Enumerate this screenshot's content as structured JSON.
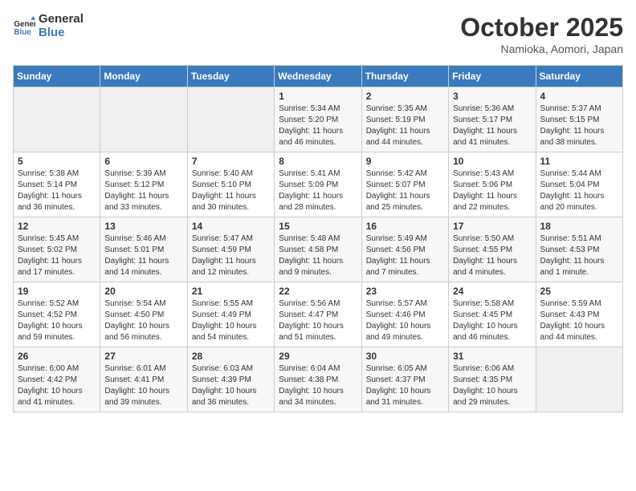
{
  "header": {
    "logo_line1": "General",
    "logo_line2": "Blue",
    "title": "October 2025",
    "subtitle": "Namioka, Aomori, Japan"
  },
  "weekdays": [
    "Sunday",
    "Monday",
    "Tuesday",
    "Wednesday",
    "Thursday",
    "Friday",
    "Saturday"
  ],
  "weeks": [
    [
      {
        "day": "",
        "empty": true
      },
      {
        "day": "",
        "empty": true
      },
      {
        "day": "",
        "empty": true
      },
      {
        "day": "1",
        "sunrise": "5:34 AM",
        "sunset": "5:20 PM",
        "daylight": "11 hours and 46 minutes."
      },
      {
        "day": "2",
        "sunrise": "5:35 AM",
        "sunset": "5:19 PM",
        "daylight": "11 hours and 44 minutes."
      },
      {
        "day": "3",
        "sunrise": "5:36 AM",
        "sunset": "5:17 PM",
        "daylight": "11 hours and 41 minutes."
      },
      {
        "day": "4",
        "sunrise": "5:37 AM",
        "sunset": "5:15 PM",
        "daylight": "11 hours and 38 minutes."
      }
    ],
    [
      {
        "day": "5",
        "sunrise": "5:38 AM",
        "sunset": "5:14 PM",
        "daylight": "11 hours and 36 minutes."
      },
      {
        "day": "6",
        "sunrise": "5:39 AM",
        "sunset": "5:12 PM",
        "daylight": "11 hours and 33 minutes."
      },
      {
        "day": "7",
        "sunrise": "5:40 AM",
        "sunset": "5:10 PM",
        "daylight": "11 hours and 30 minutes."
      },
      {
        "day": "8",
        "sunrise": "5:41 AM",
        "sunset": "5:09 PM",
        "daylight": "11 hours and 28 minutes."
      },
      {
        "day": "9",
        "sunrise": "5:42 AM",
        "sunset": "5:07 PM",
        "daylight": "11 hours and 25 minutes."
      },
      {
        "day": "10",
        "sunrise": "5:43 AM",
        "sunset": "5:06 PM",
        "daylight": "11 hours and 22 minutes."
      },
      {
        "day": "11",
        "sunrise": "5:44 AM",
        "sunset": "5:04 PM",
        "daylight": "11 hours and 20 minutes."
      }
    ],
    [
      {
        "day": "12",
        "sunrise": "5:45 AM",
        "sunset": "5:02 PM",
        "daylight": "11 hours and 17 minutes."
      },
      {
        "day": "13",
        "sunrise": "5:46 AM",
        "sunset": "5:01 PM",
        "daylight": "11 hours and 14 minutes."
      },
      {
        "day": "14",
        "sunrise": "5:47 AM",
        "sunset": "4:59 PM",
        "daylight": "11 hours and 12 minutes."
      },
      {
        "day": "15",
        "sunrise": "5:48 AM",
        "sunset": "4:58 PM",
        "daylight": "11 hours and 9 minutes."
      },
      {
        "day": "16",
        "sunrise": "5:49 AM",
        "sunset": "4:56 PM",
        "daylight": "11 hours and 7 minutes."
      },
      {
        "day": "17",
        "sunrise": "5:50 AM",
        "sunset": "4:55 PM",
        "daylight": "11 hours and 4 minutes."
      },
      {
        "day": "18",
        "sunrise": "5:51 AM",
        "sunset": "4:53 PM",
        "daylight": "11 hours and 1 minute."
      }
    ],
    [
      {
        "day": "19",
        "sunrise": "5:52 AM",
        "sunset": "4:52 PM",
        "daylight": "10 hours and 59 minutes."
      },
      {
        "day": "20",
        "sunrise": "5:54 AM",
        "sunset": "4:50 PM",
        "daylight": "10 hours and 56 minutes."
      },
      {
        "day": "21",
        "sunrise": "5:55 AM",
        "sunset": "4:49 PM",
        "daylight": "10 hours and 54 minutes."
      },
      {
        "day": "22",
        "sunrise": "5:56 AM",
        "sunset": "4:47 PM",
        "daylight": "10 hours and 51 minutes."
      },
      {
        "day": "23",
        "sunrise": "5:57 AM",
        "sunset": "4:46 PM",
        "daylight": "10 hours and 49 minutes."
      },
      {
        "day": "24",
        "sunrise": "5:58 AM",
        "sunset": "4:45 PM",
        "daylight": "10 hours and 46 minutes."
      },
      {
        "day": "25",
        "sunrise": "5:59 AM",
        "sunset": "4:43 PM",
        "daylight": "10 hours and 44 minutes."
      }
    ],
    [
      {
        "day": "26",
        "sunrise": "6:00 AM",
        "sunset": "4:42 PM",
        "daylight": "10 hours and 41 minutes."
      },
      {
        "day": "27",
        "sunrise": "6:01 AM",
        "sunset": "4:41 PM",
        "daylight": "10 hours and 39 minutes."
      },
      {
        "day": "28",
        "sunrise": "6:03 AM",
        "sunset": "4:39 PM",
        "daylight": "10 hours and 36 minutes."
      },
      {
        "day": "29",
        "sunrise": "6:04 AM",
        "sunset": "4:38 PM",
        "daylight": "10 hours and 34 minutes."
      },
      {
        "day": "30",
        "sunrise": "6:05 AM",
        "sunset": "4:37 PM",
        "daylight": "10 hours and 31 minutes."
      },
      {
        "day": "31",
        "sunrise": "6:06 AM",
        "sunset": "4:35 PM",
        "daylight": "10 hours and 29 minutes."
      },
      {
        "day": "",
        "empty": true
      }
    ]
  ]
}
